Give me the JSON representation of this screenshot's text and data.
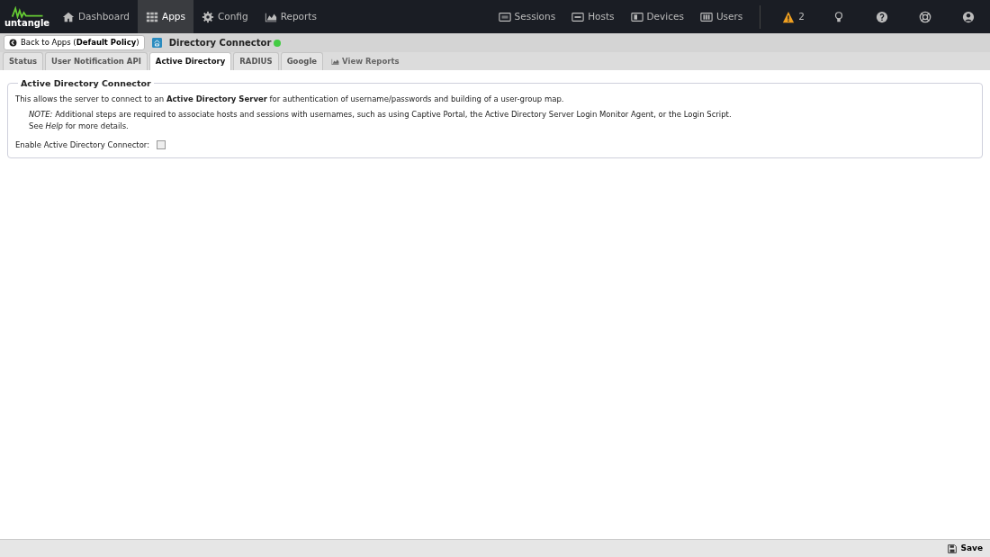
{
  "logo": {
    "text": "untangle"
  },
  "nav_left": [
    {
      "label": "Dashboard",
      "selected": false
    },
    {
      "label": "Apps",
      "selected": true
    },
    {
      "label": "Config",
      "selected": false
    },
    {
      "label": "Reports",
      "selected": false
    }
  ],
  "nav_right": [
    {
      "label": "Sessions"
    },
    {
      "label": "Hosts"
    },
    {
      "label": "Devices"
    },
    {
      "label": "Users"
    }
  ],
  "alerts": {
    "count": "2"
  },
  "back_button": {
    "label": "Back to Apps (**Default Policy**)"
  },
  "app": {
    "title": "Directory Connector",
    "running": true
  },
  "tabs": [
    {
      "label": "Status",
      "selected": false,
      "kind": "tab"
    },
    {
      "label": "User Notification API",
      "selected": false,
      "kind": "tab"
    },
    {
      "label": "Active Directory",
      "selected": true,
      "kind": "tab"
    },
    {
      "label": "RADIUS",
      "selected": false,
      "kind": "tab"
    },
    {
      "label": "Google",
      "selected": false,
      "kind": "tab"
    },
    {
      "label": "View Reports",
      "selected": false,
      "kind": "link"
    }
  ],
  "panel": {
    "legend": "Active Directory Connector",
    "description": "This allows the server to connect to an **Active Directory Server** for authentication of username/passwords and building of a user-group map.",
    "note_lines": [
      "*NOTE:* Additional steps are required to associate hosts and sessions with usernames, such as using Captive Portal, the Active Directory Server Login Monitor Agent, or the Login Script.",
      "See *Help* for more details."
    ],
    "enable": {
      "label": "Enable Active Directory Connector:",
      "checked": false
    }
  },
  "footer": {
    "save": "Save"
  }
}
